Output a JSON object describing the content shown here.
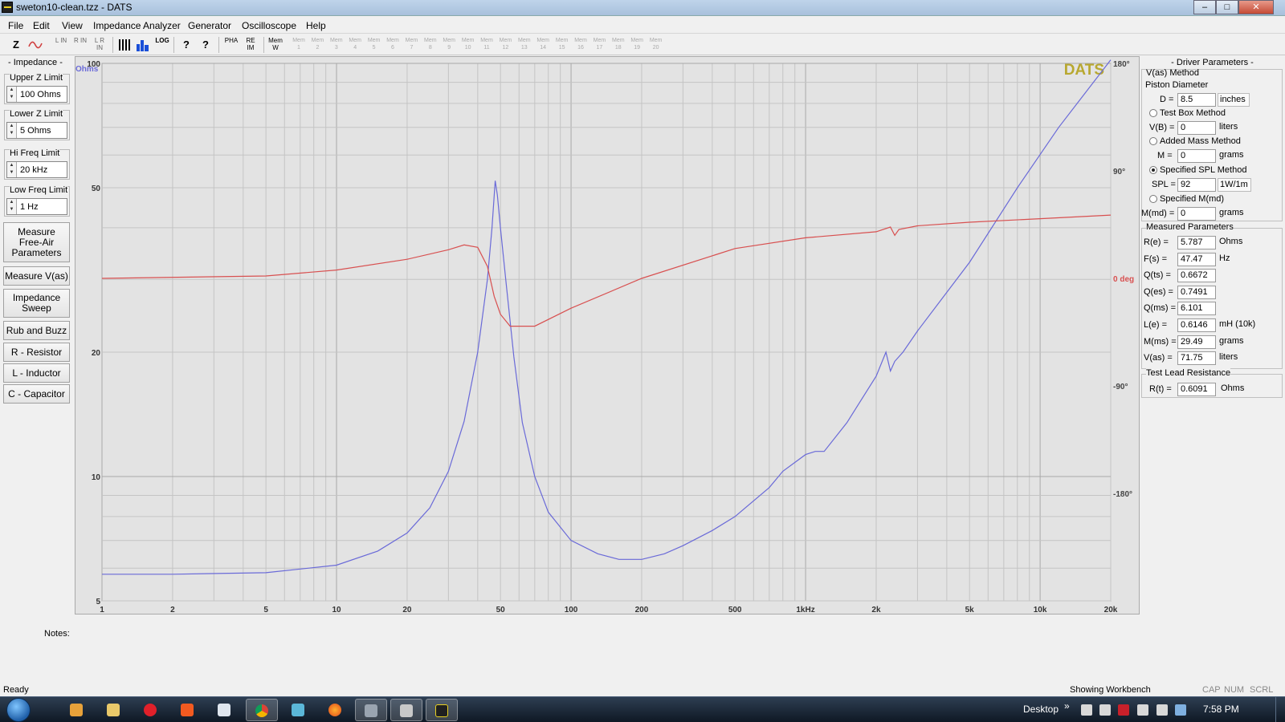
{
  "window": {
    "title": "sweton10-clean.tzz - DATS",
    "min": "–",
    "max": "□",
    "close": "✕"
  },
  "menu": [
    "File",
    "Edit",
    "View",
    "Impedance Analyzer",
    "Generator",
    "Oscilloscope",
    "Help"
  ],
  "toolbar": {
    "z": "Z",
    "l_in": "L IN",
    "r_in": "R IN",
    "lr_in": "L R IN",
    "log": "LOG",
    "help": "?",
    "whatsthis": "?",
    "pha": "PHA",
    "reim": "RE IM",
    "mem_w": "Mem W",
    "mems": [
      "Mem 1",
      "Mem 2",
      "Mem 3",
      "Mem 4",
      "Mem 5",
      "Mem 6",
      "Mem 7",
      "Mem 8",
      "Mem 9",
      "Mem 10",
      "Mem 11",
      "Mem 12",
      "Mem 13",
      "Mem 14",
      "Mem 15",
      "Mem 16",
      "Mem 17",
      "Mem 18",
      "Mem 19",
      "Mem 20"
    ]
  },
  "left": {
    "impedance_title": "- Impedance -",
    "upper": {
      "title": "Upper Z Limit",
      "value": "100 Ohms"
    },
    "lower": {
      "title": "Lower Z Limit",
      "value": "5 Ohms"
    },
    "hifreq": {
      "title": "Hi Freq Limit",
      "value": "20 kHz"
    },
    "lowfreq": {
      "title": "Low Freq Limit",
      "value": "1 Hz"
    },
    "buttons": {
      "free_air": "Measure Free-Air Parameters",
      "vas": "Measure V(as)",
      "sweep": "Impedance Sweep",
      "rub": "Rub and Buzz",
      "resistor": "R - Resistor",
      "inductor": "L - Inductor",
      "capacitor": "C - Capacitor"
    }
  },
  "chart_data": {
    "type": "line",
    "title": "",
    "watermark": "DATS",
    "x_scale": "log",
    "xlim": [
      1,
      20000
    ],
    "x_ticks": [
      1,
      2,
      5,
      10,
      20,
      50,
      100,
      200,
      500,
      1000,
      2000,
      5000,
      10000,
      20000
    ],
    "x_tick_labels": [
      "1",
      "2",
      "5",
      "10",
      "20",
      "50",
      "100",
      "200",
      "500",
      "1kHz",
      "2k",
      "5k",
      "10k",
      "20k"
    ],
    "y_scale": "log",
    "ylim": [
      5,
      100
    ],
    "y_ticks": [
      5,
      10,
      20,
      50,
      100
    ],
    "y_tick_labels": [
      "5",
      "10",
      "20",
      "50",
      "100"
    ],
    "y_unit": "Ohms",
    "y2lim": [
      -270,
      180
    ],
    "y2_ticks": [
      180,
      90,
      0,
      -90,
      -180
    ],
    "y2_tick_labels": [
      "180°",
      "90°",
      "0 deg",
      "-90°",
      "-180°"
    ],
    "grid": true,
    "colors": {
      "impedance": "#6a6ad8",
      "phase": "#d85050",
      "background": "#e3e3e3",
      "grid": "#c4c4c4",
      "major_grid": "#a8a8a8",
      "watermark": "#b8a830"
    },
    "series": [
      {
        "id": "impedance",
        "axis": "y",
        "points": [
          [
            1,
            5.8
          ],
          [
            2,
            5.8
          ],
          [
            5,
            5.85
          ],
          [
            10,
            6.1
          ],
          [
            15,
            6.6
          ],
          [
            20,
            7.3
          ],
          [
            25,
            8.4
          ],
          [
            30,
            10.3
          ],
          [
            35,
            13.6
          ],
          [
            40,
            20
          ],
          [
            44,
            30
          ],
          [
            46,
            40
          ],
          [
            47.47,
            52
          ],
          [
            48.5,
            48
          ],
          [
            50,
            40
          ],
          [
            53,
            29
          ],
          [
            57,
            19.5
          ],
          [
            62,
            13.5
          ],
          [
            70,
            10
          ],
          [
            80,
            8.2
          ],
          [
            100,
            7.0
          ],
          [
            130,
            6.5
          ],
          [
            160,
            6.3
          ],
          [
            200,
            6.3
          ],
          [
            250,
            6.5
          ],
          [
            300,
            6.8
          ],
          [
            400,
            7.4
          ],
          [
            500,
            8.0
          ],
          [
            700,
            9.4
          ],
          [
            800,
            10.3
          ],
          [
            1000,
            11.3
          ],
          [
            1100,
            11.5
          ],
          [
            1200,
            11.5
          ],
          [
            1500,
            13.5
          ],
          [
            2000,
            17.5
          ],
          [
            2200,
            20
          ],
          [
            2300,
            18
          ],
          [
            2400,
            19
          ],
          [
            2600,
            20
          ],
          [
            3000,
            22.5
          ],
          [
            5000,
            33
          ],
          [
            8000,
            50
          ],
          [
            12000,
            70
          ],
          [
            20000,
            102
          ]
        ]
      },
      {
        "id": "phase",
        "axis": "y2",
        "points": [
          [
            1,
            0
          ],
          [
            5,
            2
          ],
          [
            10,
            7
          ],
          [
            20,
            16
          ],
          [
            30,
            24
          ],
          [
            35,
            28
          ],
          [
            40,
            26
          ],
          [
            44,
            10
          ],
          [
            47,
            -15
          ],
          [
            50,
            -30
          ],
          [
            55,
            -40
          ],
          [
            70,
            -40
          ],
          [
            100,
            -25
          ],
          [
            200,
            0
          ],
          [
            500,
            25
          ],
          [
            1000,
            34
          ],
          [
            2000,
            39
          ],
          [
            2300,
            43
          ],
          [
            2400,
            36
          ],
          [
            2500,
            41
          ],
          [
            3000,
            44
          ],
          [
            5000,
            47
          ],
          [
            10000,
            50
          ],
          [
            20000,
            53
          ]
        ]
      }
    ]
  },
  "right": {
    "driver_title": "- Driver Parameters -",
    "vas_method": "V(as) Method",
    "piston": "Piston Diameter",
    "d": {
      "label": "D =",
      "value": "8.5",
      "unit": "inches"
    },
    "test_box": "Test Box Method",
    "vb": {
      "label": "V(B) =",
      "value": "0",
      "unit": "liters"
    },
    "added_mass": "Added Mass Method",
    "m": {
      "label": "M =",
      "value": "0",
      "unit": "grams"
    },
    "spl_method": "Specified SPL Method",
    "spl": {
      "label": "SPL =",
      "value": "92",
      "unit": "1W/1m"
    },
    "mmd_method": "Specified M(md)",
    "mmd": {
      "label": "M(md) =",
      "value": "0",
      "unit": "grams"
    },
    "measured_title": "Measured Parameters",
    "measured": [
      {
        "label": "R(e) =",
        "value": "5.787",
        "unit": "Ohms"
      },
      {
        "label": "F(s) =",
        "value": "47.47",
        "unit": "Hz"
      },
      {
        "label": "Q(ts) =",
        "value": "0.6672",
        "unit": ""
      },
      {
        "label": "Q(es) =",
        "value": "0.7491",
        "unit": ""
      },
      {
        "label": "Q(ms) =",
        "value": "6.101",
        "unit": ""
      },
      {
        "label": "L(e) =",
        "value": "0.6146",
        "unit": "mH (10k)"
      },
      {
        "label": "M(ms) =",
        "value": "29.49",
        "unit": "grams"
      },
      {
        "label": "V(as) =",
        "value": "71.75",
        "unit": "liters"
      }
    ],
    "lead_title": "Test Lead Resistance",
    "rt": {
      "label": "R(t) =",
      "value": "0.6091",
      "unit": "Ohms"
    }
  },
  "notes_label": "Notes:",
  "status": {
    "ready": "Ready",
    "workbench": "Showing Workbench",
    "cap": "CAP",
    "num": "NUM",
    "scrl": "SCRL"
  },
  "taskbar": {
    "desktop": "Desktop",
    "chevron": "»",
    "time": "7:58 PM"
  }
}
